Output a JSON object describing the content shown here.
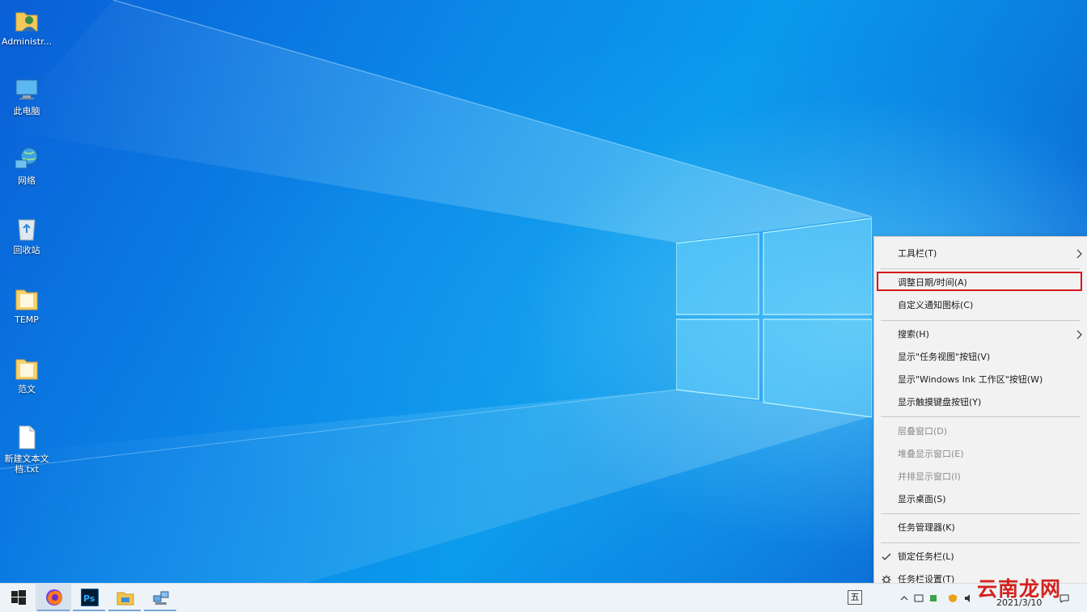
{
  "desktop": {
    "icons": [
      {
        "label": "Administr..."
      },
      {
        "label": "此电脑"
      },
      {
        "label": "网络"
      },
      {
        "label": "回收站"
      },
      {
        "label": "TEMP"
      },
      {
        "label": "范文"
      },
      {
        "label": "新建文本文档.txt"
      }
    ]
  },
  "context_menu": {
    "items": [
      {
        "label": "工具栏(T)"
      },
      {
        "label": "调整日期/时间(A)"
      },
      {
        "label": "自定义通知图标(C)"
      },
      {
        "label": "搜索(H)"
      },
      {
        "label": "显示\"任务视图\"按钮(V)"
      },
      {
        "label": "显示\"Windows Ink 工作区\"按钮(W)"
      },
      {
        "label": "显示触摸键盘按钮(Y)"
      },
      {
        "label": "层叠窗口(D)"
      },
      {
        "label": "堆叠显示窗口(E)"
      },
      {
        "label": "并排显示窗口(I)"
      },
      {
        "label": "显示桌面(S)"
      },
      {
        "label": "任务管理器(K)"
      },
      {
        "label": "锁定任务栏(L)"
      },
      {
        "label": "任务栏设置(T)"
      }
    ],
    "highlight_color": "#d8151b"
  },
  "taskbar": {
    "ime_label": "五",
    "date": "2021/3/10",
    "watermark": "云南龙网"
  }
}
